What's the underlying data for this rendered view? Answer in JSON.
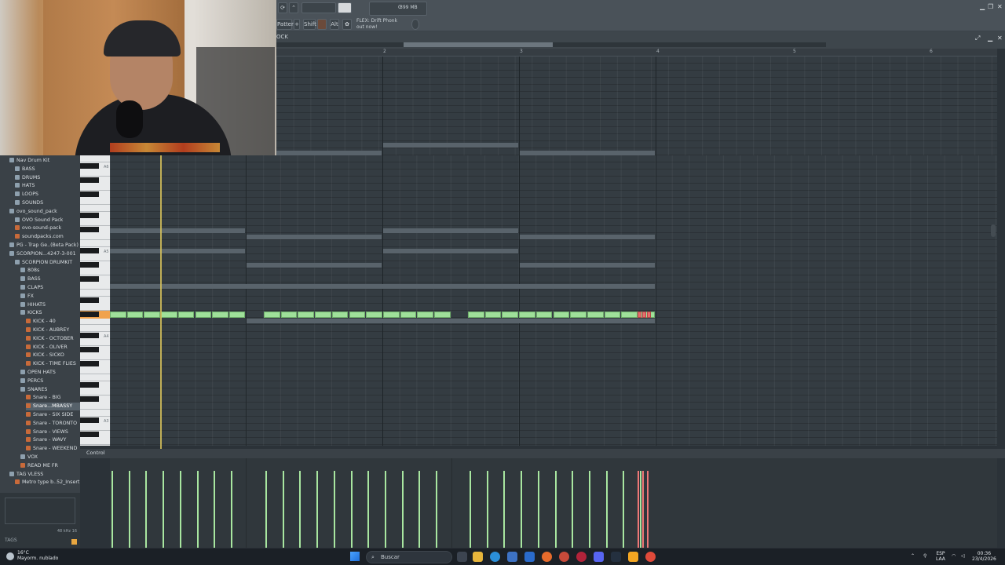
{
  "toolbar": {
    "memory": "399 MB",
    "cpu": "0",
    "shift_label": "Shift",
    "alt_label": "Alt",
    "news_text": "FLEX: Drift Phonk",
    "news_sub": "out now!",
    "pattern_label": "Pattern 1"
  },
  "piano_roll": {
    "bar_numbers": [
      "2",
      "3",
      "4",
      "5",
      "6",
      "7"
    ],
    "key_labels": [
      "A6",
      "A5",
      "A4",
      "A3"
    ],
    "control_label": "Control"
  },
  "browser": {
    "items": [
      {
        "label": "Nav Drum Kit",
        "kind": "folder",
        "indent": 0
      },
      {
        "label": "BASS",
        "kind": "folder",
        "indent": 1
      },
      {
        "label": "DRUMS",
        "kind": "folder",
        "indent": 1
      },
      {
        "label": "HATS",
        "kind": "folder",
        "indent": 1
      },
      {
        "label": "LOOPS",
        "kind": "folder",
        "indent": 1
      },
      {
        "label": "SOUNDS",
        "kind": "folder",
        "indent": 1
      },
      {
        "label": "ovo_sound_pack",
        "kind": "folder",
        "indent": 0
      },
      {
        "label": "OVO Sound Pack",
        "kind": "folder",
        "indent": 1
      },
      {
        "label": "ovo-sound-pack",
        "kind": "file",
        "indent": 1
      },
      {
        "label": "soundpacks.com",
        "kind": "file",
        "indent": 1
      },
      {
        "label": "PG - Trap Ge..(Beta Pack)",
        "kind": "folder",
        "indent": 0
      },
      {
        "label": "SCORPION...4247-3-001",
        "kind": "folder",
        "indent": 0
      },
      {
        "label": "SCORPION DRUMKIT",
        "kind": "folder",
        "indent": 1
      },
      {
        "label": "808s",
        "kind": "folder",
        "indent": 2
      },
      {
        "label": "BASS",
        "kind": "folder",
        "indent": 2
      },
      {
        "label": "CLAPS",
        "kind": "folder",
        "indent": 2
      },
      {
        "label": "FX",
        "kind": "folder",
        "indent": 2
      },
      {
        "label": "HIHATS",
        "kind": "folder",
        "indent": 2
      },
      {
        "label": "KICKS",
        "kind": "folder",
        "indent": 2
      },
      {
        "label": "KICK - 40",
        "kind": "file",
        "indent": 3
      },
      {
        "label": "KICK - AUBREY",
        "kind": "file",
        "indent": 3
      },
      {
        "label": "KICK - OCTOBER",
        "kind": "file",
        "indent": 3
      },
      {
        "label": "KICK - OLIVER",
        "kind": "file",
        "indent": 3
      },
      {
        "label": "KICK - SICKO",
        "kind": "file",
        "indent": 3
      },
      {
        "label": "KICK - TIME FLIES",
        "kind": "file",
        "indent": 3
      },
      {
        "label": "OPEN HATS",
        "kind": "folder",
        "indent": 2
      },
      {
        "label": "PERCS",
        "kind": "folder",
        "indent": 2
      },
      {
        "label": "SNARES",
        "kind": "folder",
        "indent": 2
      },
      {
        "label": "Snare - BIG",
        "kind": "file",
        "indent": 3
      },
      {
        "label": "Snare...MBASSY",
        "kind": "file",
        "indent": 3,
        "selected": true
      },
      {
        "label": "Snare - SIX SIDE",
        "kind": "file",
        "indent": 3
      },
      {
        "label": "Snare - TORONTO",
        "kind": "file",
        "indent": 3
      },
      {
        "label": "Snare - VIEWS",
        "kind": "file",
        "indent": 3
      },
      {
        "label": "Snare - WAVY",
        "kind": "file",
        "indent": 3
      },
      {
        "label": "Snare - WEEKEND",
        "kind": "file",
        "indent": 3
      },
      {
        "label": "VOX",
        "kind": "folder",
        "indent": 2
      },
      {
        "label": "READ ME FR",
        "kind": "file",
        "indent": 2
      },
      {
        "label": "TAG VLESS",
        "kind": "folder",
        "indent": 0
      },
      {
        "label": "Metro type b..52_Insert 1",
        "kind": "file",
        "indent": 1
      }
    ],
    "tags_label": "TAGS",
    "sample_info": "48 kHz 16"
  },
  "taskbar": {
    "temperature": "16°C",
    "weather": "Mayorm. nublado",
    "search_placeholder": "Buscar",
    "lang_line1": "ESP",
    "lang_line2": "LAA",
    "time": "00:36",
    "date": "23/4/2026"
  },
  "colors": {
    "note_green": "#9fe09a",
    "note_red": "#e86b6b",
    "playhead": "#d9c35a",
    "key_highlight": "#f0a24c"
  }
}
